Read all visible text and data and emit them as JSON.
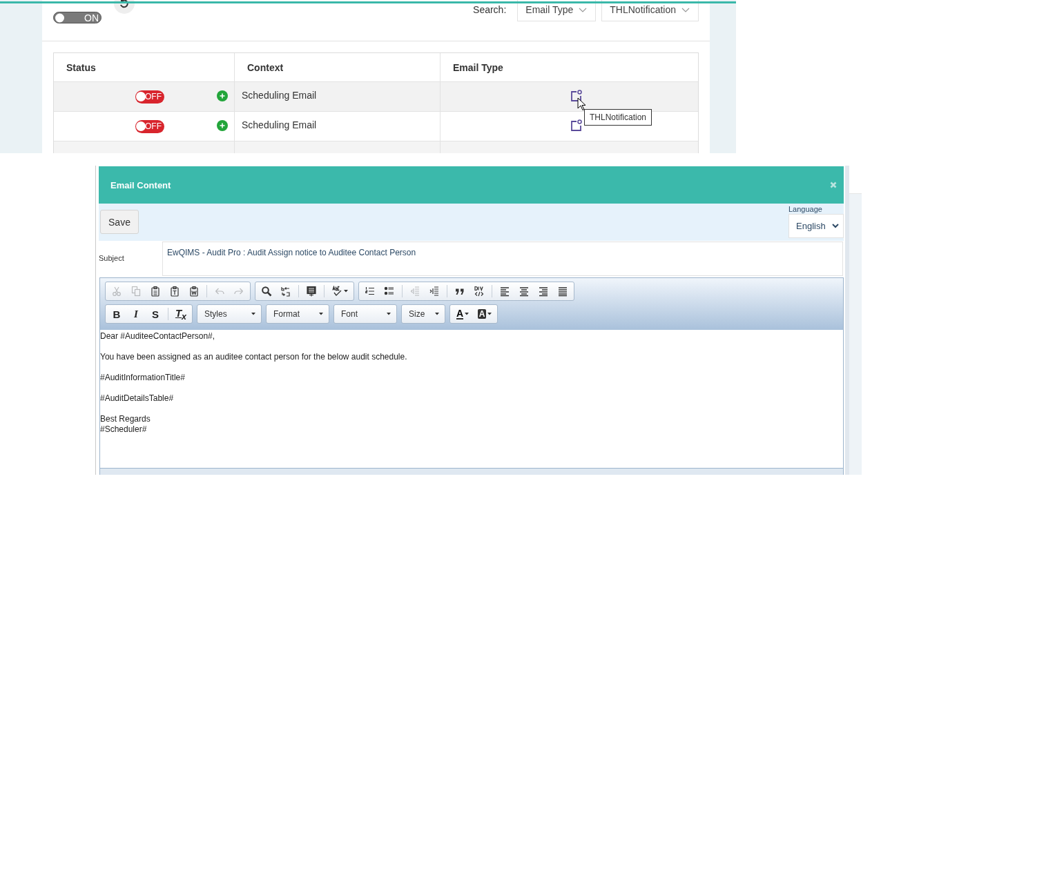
{
  "list_page": {
    "master_toggle": {
      "label": "ON",
      "on": true
    },
    "search": {
      "label": "Search:",
      "filters": [
        {
          "value": "Email Type"
        },
        {
          "value": "THLNotification"
        }
      ]
    },
    "table": {
      "columns": [
        "Status",
        "Context",
        "Email Type"
      ],
      "rows": [
        {
          "status": {
            "label": "OFF",
            "on": false
          },
          "context": "Scheduling Email",
          "shaded": true
        },
        {
          "status": {
            "label": "OFF",
            "on": false
          },
          "context": "Scheduling Email",
          "shaded": false
        }
      ]
    },
    "tooltip": "THLNotification"
  },
  "modal": {
    "title": "Email Content",
    "save": "Save",
    "language": {
      "label": "Language",
      "value": "English"
    },
    "subject": {
      "label": "Subject",
      "value": "EwQIMS - Audit Pro : Audit Assign notice to Auditee Contact Person"
    },
    "toolbar_rows": [
      [
        [
          [
            {
              "kind": "cut",
              "disabled": true
            },
            {
              "kind": "copy",
              "disabled": true
            },
            {
              "kind": "paste",
              "disabled": false
            },
            {
              "kind": "pastetext",
              "disabled": false
            },
            {
              "kind": "pasteword",
              "disabled": false
            }
          ],
          [
            {
              "kind": "undo",
              "disabled": true
            },
            {
              "kind": "redo",
              "disabled": true
            }
          ]
        ],
        [
          [
            {
              "kind": "find",
              "disabled": false
            },
            {
              "kind": "replace",
              "disabled": false
            }
          ],
          [
            {
              "kind": "selectall",
              "disabled": false
            }
          ],
          [
            {
              "kind": "spellcheck",
              "disabled": false
            }
          ]
        ],
        [
          [
            {
              "kind": "numbered",
              "disabled": false
            },
            {
              "kind": "bulleted",
              "disabled": false
            }
          ],
          [
            {
              "kind": "outdent",
              "disabled": true
            },
            {
              "kind": "indent",
              "disabled": false
            }
          ],
          [
            {
              "kind": "quote",
              "disabled": false
            },
            {
              "kind": "div",
              "disabled": false
            }
          ],
          [
            {
              "kind": "alignleft",
              "disabled": false
            },
            {
              "kind": "aligncenter",
              "disabled": false
            },
            {
              "kind": "alignright",
              "disabled": false
            },
            {
              "kind": "justify",
              "disabled": false
            }
          ]
        ]
      ],
      [
        [
          [
            {
              "kind": "bold",
              "label": "B"
            },
            {
              "kind": "italic",
              "label": "I"
            },
            {
              "kind": "strike",
              "label": "S"
            }
          ],
          [
            {
              "kind": "clearformat",
              "label": "T$_{x}$"
            }
          ]
        ],
        [
          [
            {
              "kind": "dropdown",
              "label": "Styles"
            }
          ]
        ],
        [
          [
            {
              "kind": "dropdown",
              "label": "Format"
            }
          ]
        ],
        [
          [
            {
              "kind": "dropdown",
              "label": "Font"
            }
          ]
        ],
        [
          [
            {
              "kind": "dropdown",
              "label": "Size"
            }
          ]
        ],
        [
          [
            {
              "kind": "textcolor",
              "label": "A"
            },
            {
              "kind": "bgcolor",
              "label": "A"
            }
          ]
        ]
      ]
    ],
    "body": [
      [
        "Dear #AuditeeContactPerson#,"
      ],
      [
        "You have been assigned as an auditee contact person for the below audit schedule."
      ],
      [
        "#AuditInformationTitle#"
      ],
      [
        "#AuditDetailsTable#"
      ],
      [
        "Best Regards",
        "#Scheduler#"
      ]
    ]
  }
}
